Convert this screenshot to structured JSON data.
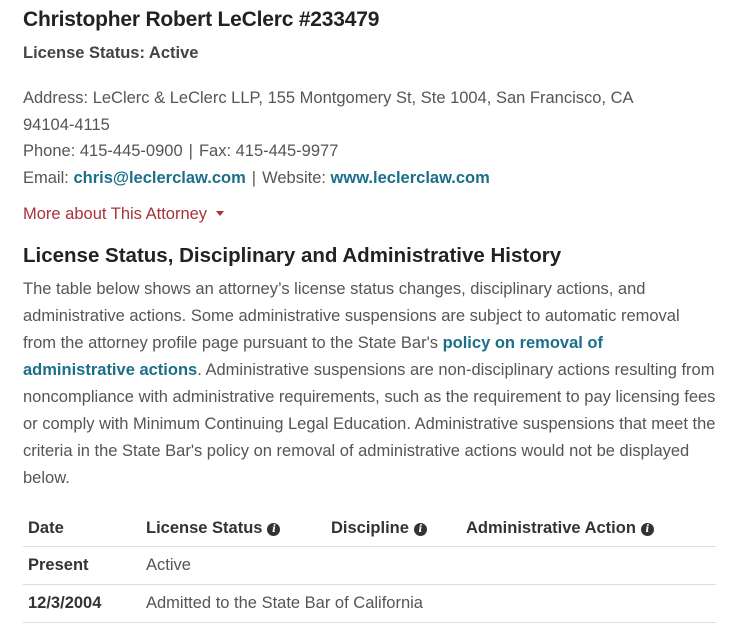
{
  "attorney": {
    "name": "Christopher Robert LeClerc #233479",
    "license_status_line": "License Status: Active"
  },
  "contact": {
    "address_line1": "Address: LeClerc & LeClerc LLP, 155 Montgomery St, Ste 1004, San Francisco, CA",
    "address_line2": "94104-4115",
    "phone_label": "Phone: 415-445-0900",
    "separator": "|",
    "fax_label": "Fax: 415-445-9977",
    "email_prefix": "Email: ",
    "email": "chris@leclerclaw.com",
    "website_prefix": "Website: ",
    "website": "www.leclerclaw.com"
  },
  "more_link": "More about This Attorney",
  "history": {
    "title": "License Status, Disciplinary and Administrative History",
    "para_part1": "The table below shows an attorney’s license status changes, disciplinary actions, and administrative actions. Some administrative suspensions are subject to automatic removal from the attorney profile page pursuant to the State Bar's ",
    "para_link": "policy on removal of administrative actions",
    "para_part2": ". Administrative suspensions are non-disciplinary actions resulting from noncompliance with administrative requirements, such as the requirement to pay licensing fees or comply with Minimum Continuing Legal Education. Administrative suspensions that meet the criteria in the State Bar's policy on removal of administrative actions would not be displayed below."
  },
  "table": {
    "headers": {
      "date": "Date",
      "license_status": "License Status",
      "discipline": "Discipline",
      "administrative_action": "Administrative Action"
    },
    "info_icon_glyph": "i",
    "rows": [
      {
        "date": "Present",
        "status": "Active",
        "discipline": "",
        "admin": ""
      },
      {
        "date": "12/3/2004",
        "status": "Admitted to the State Bar of California",
        "discipline": "",
        "admin": ""
      }
    ]
  }
}
